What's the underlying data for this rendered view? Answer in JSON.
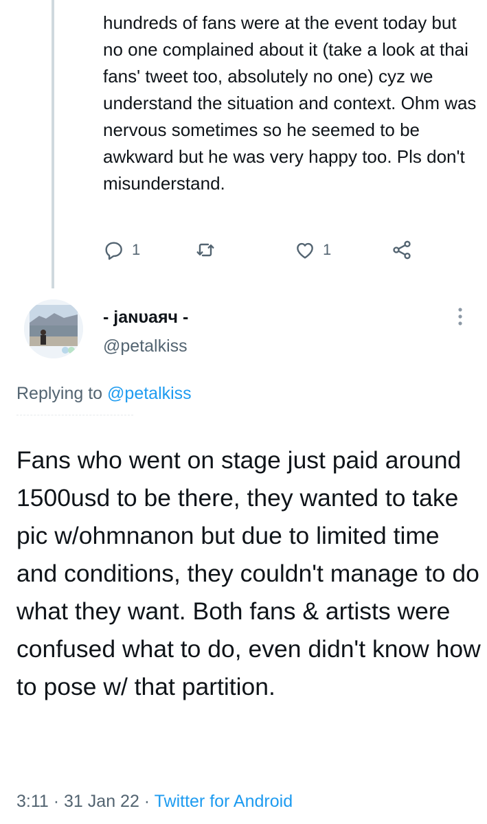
{
  "previous_tweet": {
    "text": "hundreds of fans were at the event today but no one complained about it (take a look at thai fans' tweet too, absolutely no one) cyz we understand the situation and context. Ohm was nervous sometimes so he seemed to be awkward but he was very happy too. Pls don't misunderstand.",
    "reply_count": "1",
    "like_count": "1",
    "icons": [
      "reply-icon",
      "retweet-icon",
      "like-icon",
      "share-icon"
    ]
  },
  "author": {
    "display_name": "- jаɴυаяч -",
    "handle": "@petalkiss",
    "avatar_icon": "avatar-photo"
  },
  "replying": {
    "prefix": "Replying to ",
    "mention": "@petalkiss"
  },
  "main_tweet": {
    "text": "Fans who went on stage just paid around 1500usd to be there, they wanted to take pic w/ohmnanon but due to limited time and conditions, they couldn't manage to do what they want. Both fans & artists were confused what to do, even didn't know how to pose w/ that partition.",
    "time": "3:11",
    "date": "31 Jan 22",
    "separator": " · ",
    "source": "Twitter for Android"
  },
  "colors": {
    "accent": "#1d9bf0",
    "secondary_text": "#536471",
    "primary_text": "#0f1419",
    "thread_line": "#cfd9de"
  }
}
